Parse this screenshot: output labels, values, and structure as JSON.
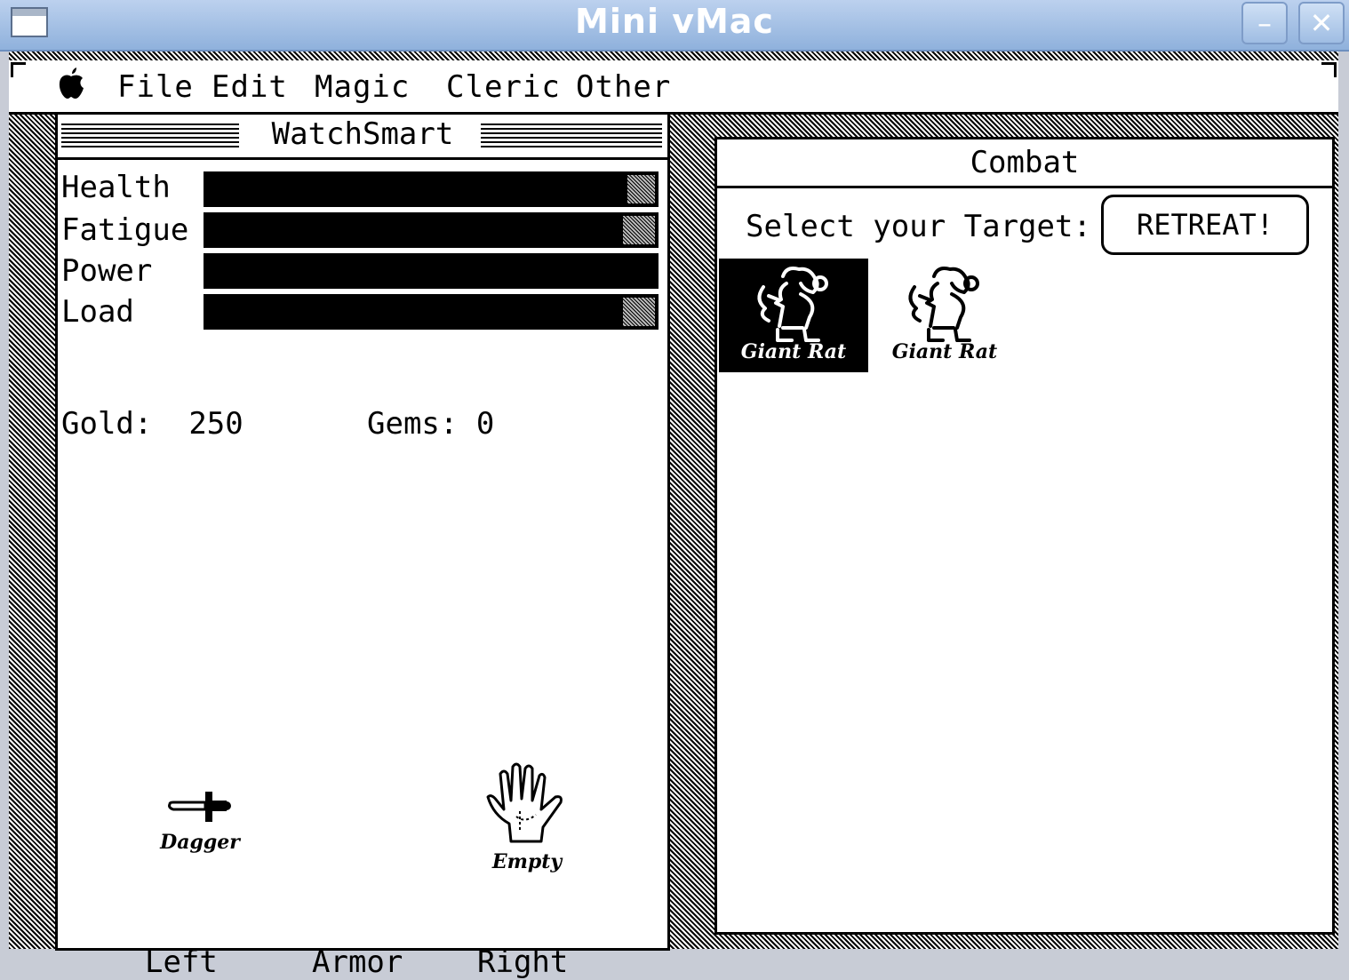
{
  "window": {
    "title": "Mini vMac"
  },
  "menubar": {
    "items": [
      "File",
      "Edit",
      "Magic",
      "Cleric",
      "Other"
    ]
  },
  "watchsmart": {
    "title": "WatchSmart",
    "stats": [
      {
        "label": "Health",
        "level": 0.94
      },
      {
        "label": "Fatigue",
        "level": 0.93
      },
      {
        "label": "Power",
        "level": 1.0
      },
      {
        "label": "Load",
        "level": 0.93
      }
    ],
    "gold_label": "Gold:",
    "gold_value": "250",
    "gems_label": "Gems:",
    "gems_value": "0",
    "equipment": {
      "left_item": "Dagger",
      "right_item": "Empty"
    },
    "slots": {
      "left": "Left",
      "armor": "Armor",
      "right": "Right"
    }
  },
  "combat": {
    "title": "Combat",
    "prompt": "Select your Target:",
    "retreat_label": "RETREAT!",
    "targets": [
      {
        "name": "Giant Rat",
        "selected": true
      },
      {
        "name": "Giant Rat",
        "selected": false
      }
    ]
  },
  "icons": [
    "window-menu-icon",
    "minimize-icon",
    "close-icon",
    "apple-icon",
    "dagger-icon",
    "hand-icon",
    "giant-rat-icon"
  ]
}
